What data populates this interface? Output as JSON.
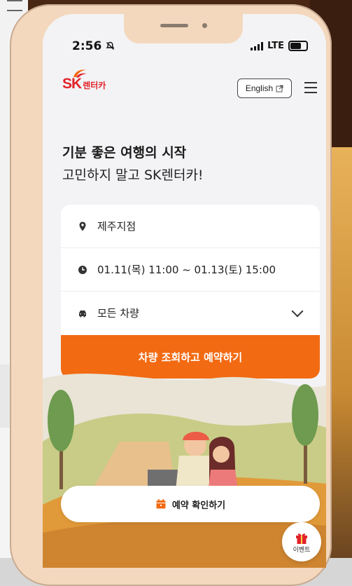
{
  "status_bar": {
    "time": "2:56",
    "network": "LTE"
  },
  "header": {
    "logo_text": "SK",
    "logo_sub": "렌터카",
    "lang_button": "English",
    "colors": {
      "brand_red": "#e1242a",
      "brand_orange": "#f26a12"
    }
  },
  "hero": {
    "title": "기분 좋은 여행의 시작",
    "subtitle": "고민하지 말고 SK렌터카!"
  },
  "booking": {
    "location": "제주지점",
    "datetime": "01.11(목) 11:00 ~ 01.13(토) 15:00",
    "car_type": "모든 차량",
    "cta_label": "차량 조회하고 예약하기"
  },
  "confirm_button": "예약 확인하기",
  "event_button": "이벤트",
  "icons": [
    "location-pin-icon",
    "clock-icon",
    "car-icon",
    "chevron-down-icon",
    "external-link-icon",
    "hamburger-menu-icon",
    "calendar-icon",
    "gift-icon"
  ]
}
